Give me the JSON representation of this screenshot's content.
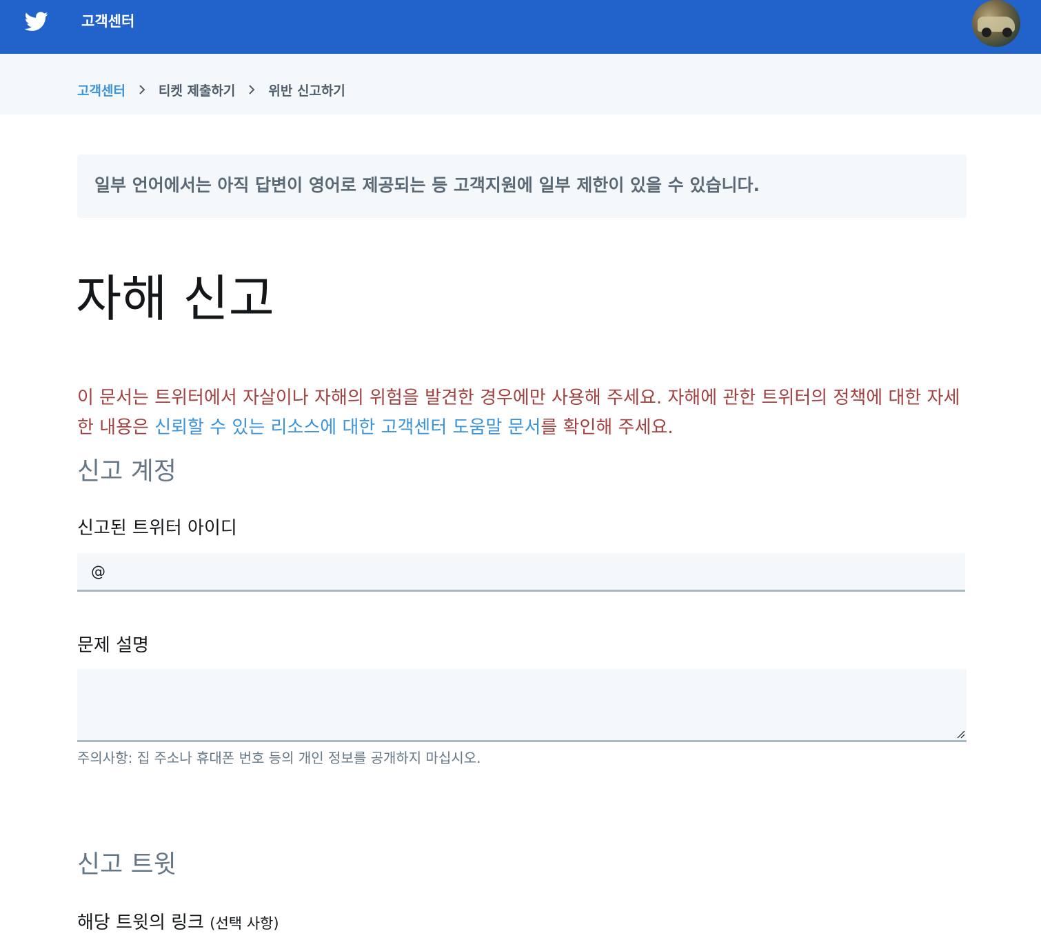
{
  "header": {
    "brand": "고객센터",
    "logo_icon": "twitter-bird-icon",
    "avatar_icon": "user-avatar"
  },
  "breadcrumb": {
    "items": [
      {
        "label": "고객센터",
        "link": true
      },
      {
        "label": "티켓 제출하기",
        "link": false
      },
      {
        "label": "위반 신고하기",
        "link": false
      }
    ],
    "separator_icon": "chevron-right-icon"
  },
  "notice": {
    "text": "일부 언어에서는 아직 답변이 영어로 제공되는 등 고객지원에 일부 제한이 있을 수 있습니다."
  },
  "page": {
    "title": "자해 신고"
  },
  "warning": {
    "part1": "이 문서는 트위터에서 자살이나 자해의 위험을 발견한 경우에만 사용해 주세요. 자해에 관한 트위터의 정책에 대한 자세한 내용은 ",
    "link_text": "신뢰할 수 있는 리소스에 대한 고객센터 도움말 문서",
    "part2": "를 확인해 주세요."
  },
  "section_account": {
    "heading": "신고 계정",
    "id_label": "신고된 트위터 아이디",
    "id_prefix": "@",
    "id_value": "",
    "desc_label": "문제 설명",
    "desc_value": "",
    "hint": "주의사항: 집 주소나 휴대폰 번호 등의 개인 정보를 공개하지 마십시오."
  },
  "section_tweet": {
    "heading": "신고 트윗",
    "link_label": "해당 트윗의 링크",
    "link_optional": "(선택 사항)"
  },
  "colors": {
    "header_bg": "#2162cb",
    "link": "#3b94d9",
    "warning": "#a2413f",
    "muted": "#657786"
  }
}
